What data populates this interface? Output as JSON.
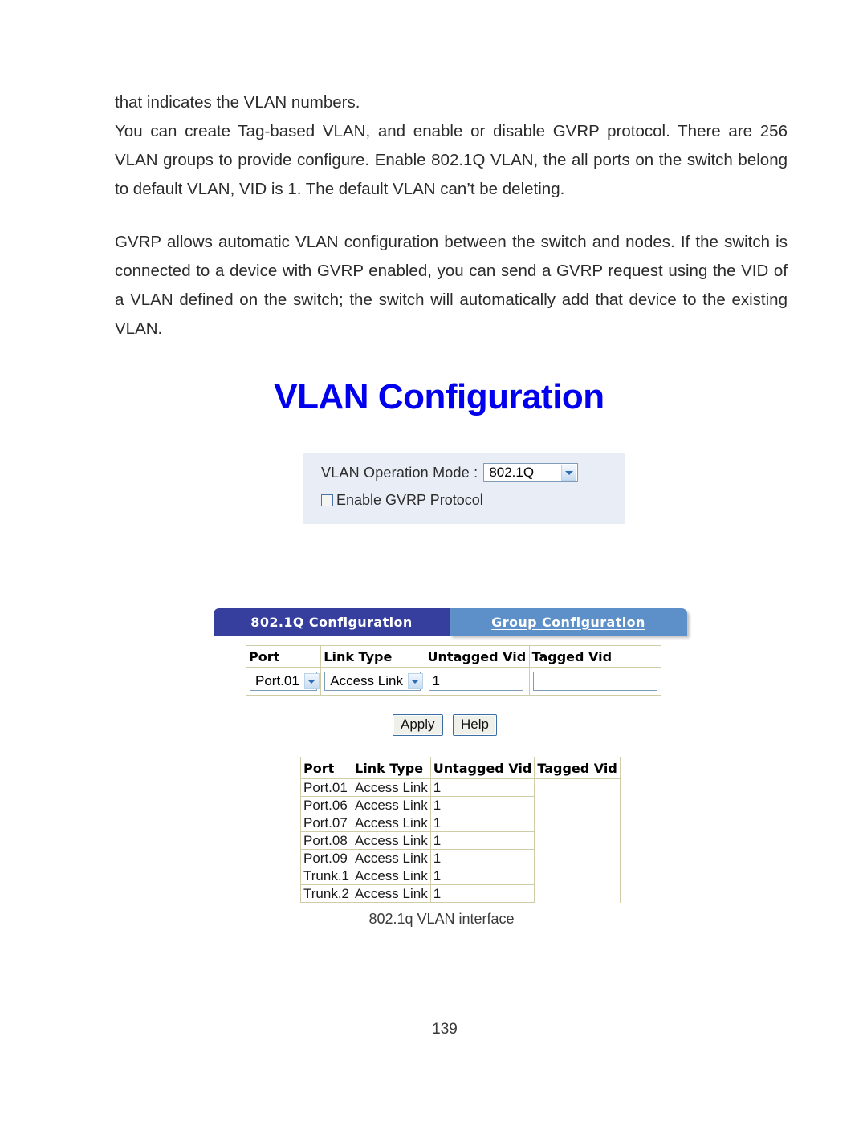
{
  "document": {
    "page_number": "139",
    "paragraphs": [
      "that indicates the VLAN numbers.",
      "You can create Tag-based VLAN, and enable or disable GVRP protocol. There are 256 VLAN groups to provide configure. Enable 802.1Q VLAN, the all ports on the switch belong to default VLAN, VID is 1. The default VLAN can’t be deleting.",
      "GVRP allows automatic VLAN configuration between the switch and nodes. If the switch is connected to a device with GVRP enabled, you can send a GVRP request using the VID of a VLAN defined on the switch; the switch will automatically add that device to the existing VLAN."
    ],
    "figure_caption": "802.1q VLAN interface"
  },
  "ui": {
    "title": "VLAN Configuration",
    "title_color": "#0000ee",
    "mode_panel": {
      "background": "#e9eef6",
      "operation_mode_label": "VLAN Operation Mode :",
      "operation_mode_value": "802.1Q",
      "operation_mode_options": [
        "802.1Q"
      ],
      "gvrp_checkbox_label": "Enable GVRP Protocol",
      "gvrp_checked": false
    },
    "tabs": {
      "active_label": "802.1Q Configuration",
      "active_color": "#363e9e",
      "inactive_label": "Group Configuration",
      "inactive_color": "#5d8fc8"
    },
    "edit_table": {
      "headers": [
        "Port",
        "Link Type",
        "Untagged Vid",
        "Tagged Vid"
      ],
      "port_value": "Port.01",
      "port_options": [
        "Port.01"
      ],
      "link_type_value": "Access Link",
      "link_type_options": [
        "Access Link"
      ],
      "untagged_vid_value": "1",
      "tagged_vid_value": ""
    },
    "buttons": {
      "apply_label": "Apply",
      "help_label": "Help"
    },
    "result_table": {
      "headers": [
        "Port",
        "Link Type",
        "Untagged Vid",
        "Tagged Vid"
      ],
      "rows": [
        {
          "port": "Port.01",
          "link_type": "Access Link",
          "untagged_vid": "1",
          "tagged_vid": ""
        },
        {
          "port": "Port.06",
          "link_type": "Access Link",
          "untagged_vid": "1",
          "tagged_vid": ""
        },
        {
          "port": "Port.07",
          "link_type": "Access Link",
          "untagged_vid": "1",
          "tagged_vid": ""
        },
        {
          "port": "Port.08",
          "link_type": "Access Link",
          "untagged_vid": "1",
          "tagged_vid": ""
        },
        {
          "port": "Port.09",
          "link_type": "Access Link",
          "untagged_vid": "1",
          "tagged_vid": ""
        },
        {
          "port": "Trunk.1",
          "link_type": "Access Link",
          "untagged_vid": "1",
          "tagged_vid": ""
        },
        {
          "port": "Trunk.2",
          "link_type": "Access Link",
          "untagged_vid": "1",
          "tagged_vid": ""
        }
      ]
    }
  }
}
